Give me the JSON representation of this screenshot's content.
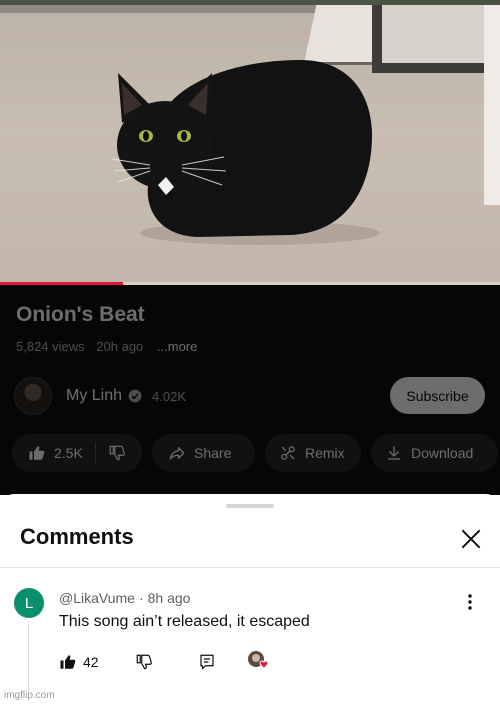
{
  "video": {
    "progress_fraction": 0.245,
    "accent_color": "#e3173e"
  },
  "details": {
    "title": "Onion's Beat",
    "views": "5,824 views",
    "age": "20h ago",
    "more_label": "...more"
  },
  "channel": {
    "name": "My Linh",
    "subscriber_count": "4.02K",
    "subscribe_label": "Subscribe",
    "verified_icon": "verified-badge-icon"
  },
  "actions": {
    "like_count": "2.5K",
    "share_label": "Share",
    "remix_label": "Remix",
    "download_label": "Download"
  },
  "comments_sheet": {
    "title": "Comments",
    "close_icon": "close-icon"
  },
  "comments": [
    {
      "avatar_letter": "L",
      "avatar_color": "#0a8f6d",
      "author": "@LikaVume",
      "time": "8h ago",
      "text": "This song ain’t released, it escaped",
      "likes": "42",
      "creator_heart": true
    }
  ],
  "watermark": "imgflip.com"
}
